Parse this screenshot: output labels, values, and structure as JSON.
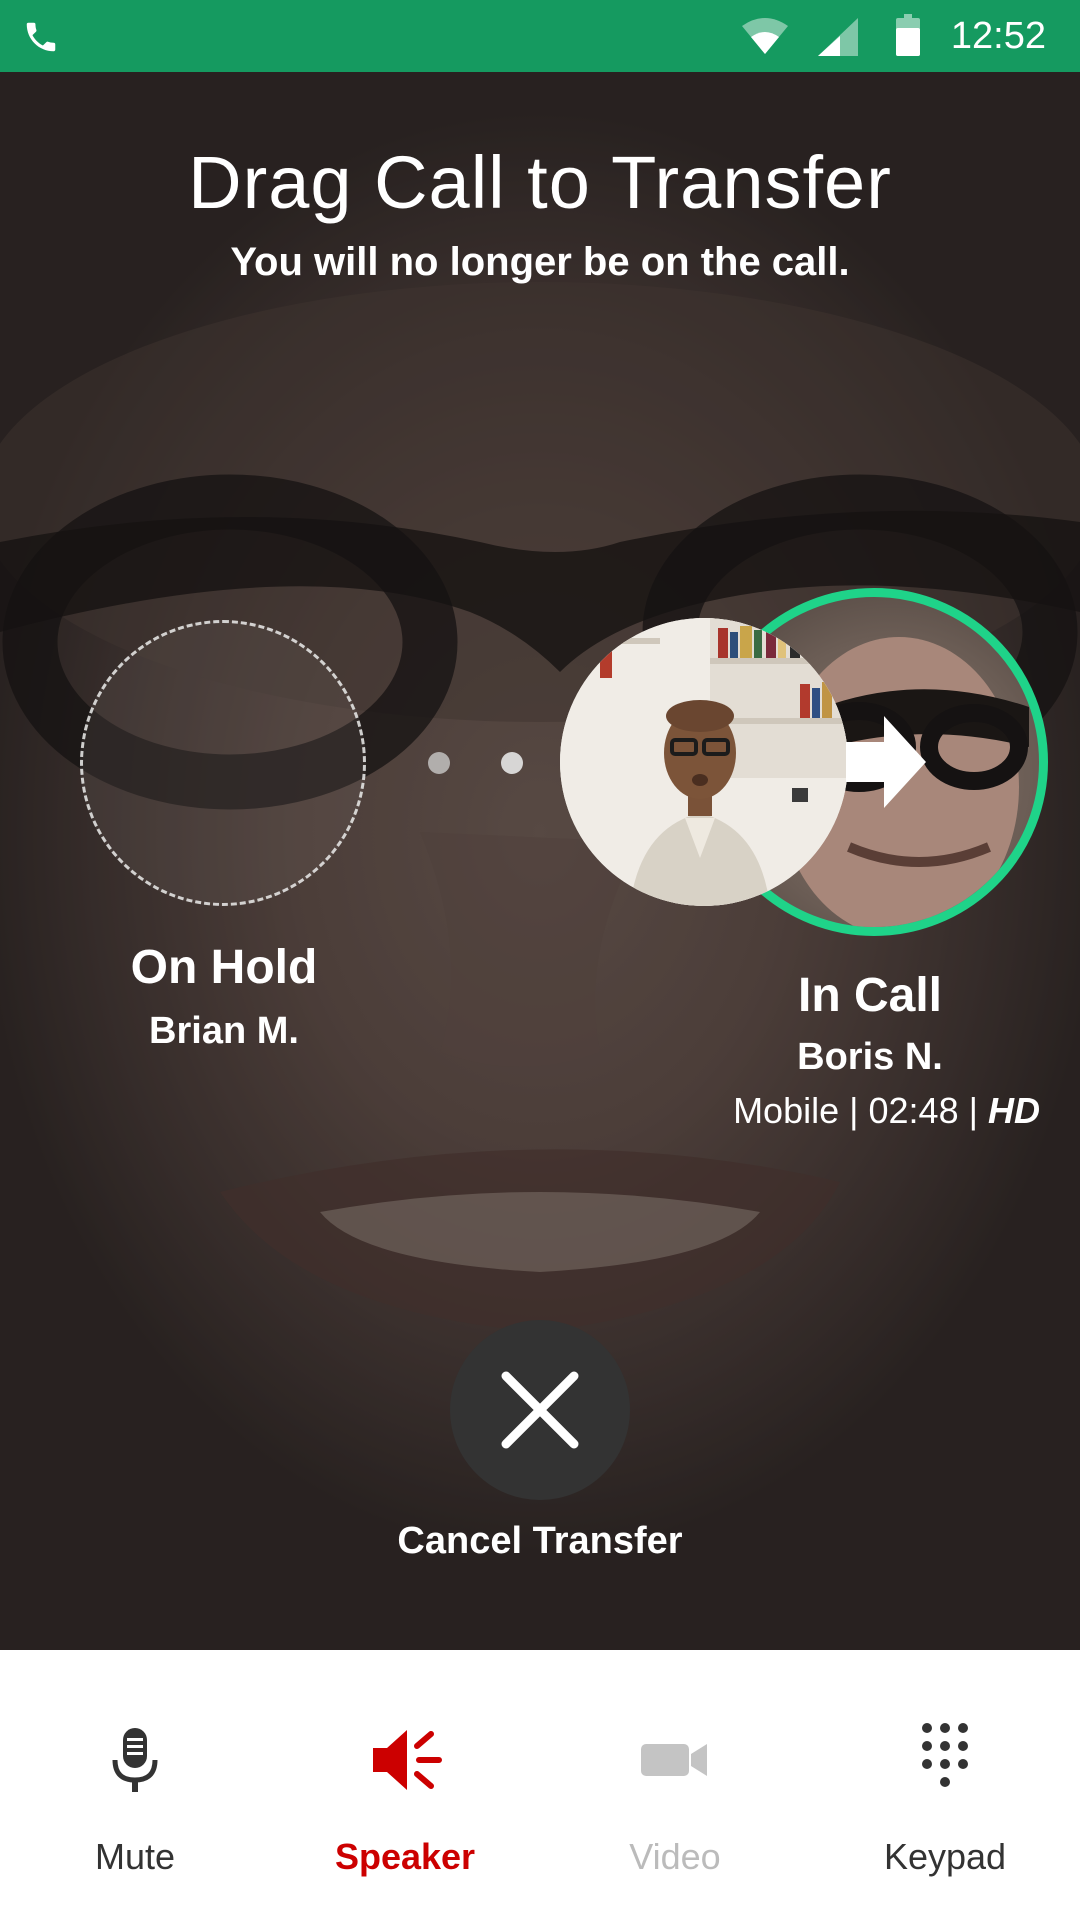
{
  "status_bar": {
    "time": "12:52",
    "icons": [
      "phone-icon",
      "wifi-icon",
      "signal-icon",
      "battery-icon"
    ],
    "background_color": "#159a60"
  },
  "header": {
    "title": "Drag Call to Transfer",
    "subtitle": "You will no longer be on the call."
  },
  "on_hold": {
    "title": "On Hold",
    "name": "Brian M."
  },
  "in_call": {
    "title": "In Call",
    "name": "Boris N.",
    "meta_type": "Mobile",
    "meta_duration": "02:48",
    "meta_quality": "HD",
    "separator": "|",
    "ring_color": "#1fd389"
  },
  "cancel": {
    "label": "Cancel Transfer",
    "icon": "close-icon"
  },
  "bottom_bar": {
    "tabs": [
      {
        "label": "Mute",
        "icon": "microphone-icon",
        "color": "#333333",
        "state": "normal"
      },
      {
        "label": "Speaker",
        "icon": "speaker-icon",
        "color": "#cc0000",
        "state": "active"
      },
      {
        "label": "Video",
        "icon": "video-camera-icon",
        "color": "#bbbbbb",
        "state": "disabled"
      },
      {
        "label": "Keypad",
        "icon": "keypad-icon",
        "color": "#333333",
        "state": "normal"
      }
    ]
  }
}
